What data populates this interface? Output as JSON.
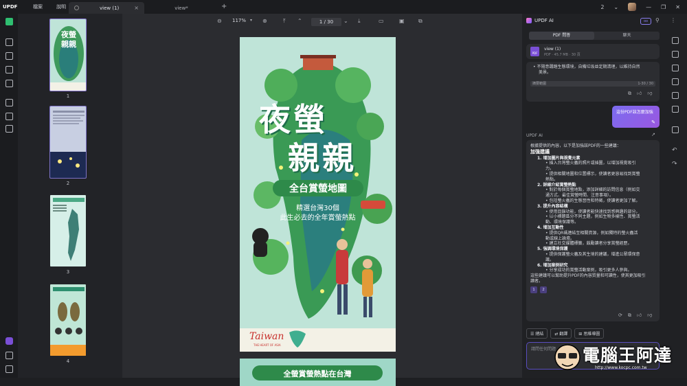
{
  "app": {
    "logo": "UPDF",
    "menu": [
      "檔案",
      "說明"
    ]
  },
  "tabs": [
    {
      "label": "view (1)",
      "active": true
    },
    {
      "label": "view*",
      "active": false
    }
  ],
  "titlebar_right": {
    "page_count_badge": "2"
  },
  "toolbar": {
    "zoom": "117%",
    "page_current": "1",
    "page_total": "30",
    "page_display": "1 / 30"
  },
  "thumbnails": [
    {
      "num": "1"
    },
    {
      "num": "2"
    },
    {
      "num": "3"
    },
    {
      "num": "4"
    }
  ],
  "document": {
    "title_line1": "夜螢",
    "title_line2": "親親",
    "banner": "全台賞螢地圖",
    "subtitle1": "精選台灣30個",
    "subtitle2": "此生必去的全年賞螢熱點",
    "brand": "Taiwan",
    "brand_tag": "THE HEART OF ASIA",
    "page2_text": "全螢賞螢熱點在台灣"
  },
  "ai_panel": {
    "title": "UPDF AI",
    "segments": [
      "PDF 問答",
      "聊天"
    ],
    "file_name": "view (1)",
    "file_meta": "PDF · 45.7 MB · 30 頁",
    "prev_text1": "• 不隨意踐踏生態環境，自備垃圾並定期清理，以維持自然",
    "prev_text2": "美景。",
    "range_label": "摘要範圍",
    "range_value": "1-30 / 30",
    "user_msg": "這份PDF該怎麼加強",
    "ai_label": "UPDF AI",
    "answer_intro": "根據提供的內容，以下是加強該PDF的一些建議：",
    "answer_heading": "加強建議",
    "answer_items": [
      {
        "title": "1. 增加圖片與視覺元素",
        "subs": [
          "• 插入台灣螢火蟲的照片或插圖，以增加視覺吸引",
          "力。",
          "• 提供相關地圖和位置標示，使讀者更容易找到賞螢",
          "熱點。"
        ]
      },
      {
        "title": "2. 詳細介紹賞螢熱點",
        "subs": [
          "• 對於每個賞螢地點，添加詳細的訪問信息（例如交",
          "通方式、最佳賞螢時間、注意事項）。",
          "• 包括螢火蟲的生態習性和特徵，使讀者更加了解。"
        ]
      },
      {
        "title": "3. 提升內容結構",
        "subs": [
          "• 使用目錄功能，使讀者能快速找到感興趣的部分。",
          "• 以小標題區分不同主題，例如生物多樣性、賞螢活",
          "動、環境保護等。"
        ]
      },
      {
        "title": "4. 增加互動性",
        "subs": [
          "• 提供QR碼連結至相關資源，例如獨特的螢火蟲活",
          "動或線上論壇。",
          "• 建立社交媒體標籤，鼓勵讀者分享賞螢經歷。"
        ]
      },
      {
        "title": "5. 強調環境保護",
        "subs": [
          "• 提供保護螢火蟲及其生境的建議，增進公眾環保意",
          "識。"
        ]
      },
      {
        "title": "6. 增加案例研究",
        "subs": [
          "• 分享成功的賞螢活動案例，吸引更多人參與。"
        ]
      }
    ],
    "answer_outro1": "這些建議可以幫助提升PDF的內容質量和可讀性，使其更加吸引",
    "answer_outro2": "讀者。",
    "refs": [
      "1",
      "2"
    ],
    "chips": [
      "總結",
      "翻譯",
      "思維導圖"
    ],
    "input_placeholder": "請問任何問題"
  },
  "watermark": {
    "text": "電腦王阿達",
    "url": "http://www.kocpc.com.tw"
  }
}
